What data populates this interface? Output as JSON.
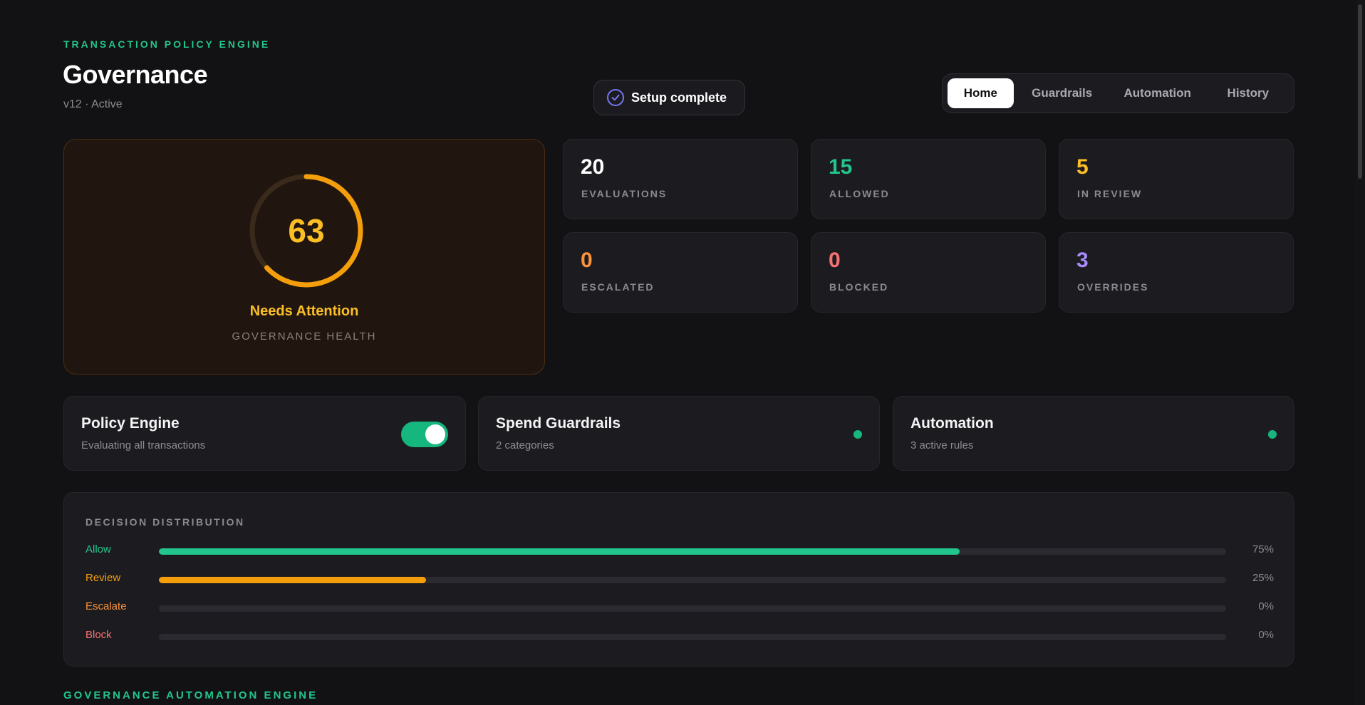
{
  "header": {
    "eyebrow": "TRANSACTION POLICY ENGINE",
    "title": "Governance",
    "subtitle": "v12 · Active",
    "setup_label": "Setup complete",
    "setup_icon": "check-circle-icon"
  },
  "tabs": [
    {
      "label": "Home",
      "active": true
    },
    {
      "label": "Guardrails",
      "active": false
    },
    {
      "label": "Automation",
      "active": false
    },
    {
      "label": "History",
      "active": false
    }
  ],
  "health": {
    "score": "63",
    "score_fraction": 0.63,
    "status": "Needs Attention",
    "caption": "GOVERNANCE HEALTH",
    "color": "#fbbf24"
  },
  "stats": [
    {
      "value": "20",
      "label": "EVALUATIONS",
      "color": "#ffffff"
    },
    {
      "value": "15",
      "label": "ALLOWED",
      "color": "#22c58b"
    },
    {
      "value": "5",
      "label": "IN REVIEW",
      "color": "#fbbf24"
    },
    {
      "value": "0",
      "label": "ESCALATED",
      "color": "#fb923c"
    },
    {
      "value": "0",
      "label": "BLOCKED",
      "color": "#f87171"
    },
    {
      "value": "3",
      "label": "OVERRIDES",
      "color": "#a78bfa"
    }
  ],
  "features": [
    {
      "name": "Policy Engine",
      "desc": "Evaluating all transactions",
      "toggle_on": true
    },
    {
      "name": "Spend Guardrails",
      "desc": "2 categories",
      "status_color": "#16b77f"
    },
    {
      "name": "Automation",
      "desc": "3 active rules",
      "status_color": "#16b77f"
    }
  ],
  "distribution": {
    "title": "DECISION DISTRIBUTION",
    "rows": [
      {
        "label": "Allow",
        "pct_text": "75%",
        "fraction": 0.75,
        "color": "#22c58b"
      },
      {
        "label": "Review",
        "pct_text": "25%",
        "fraction": 0.25,
        "color": "#f59e0b"
      },
      {
        "label": "Escalate",
        "pct_text": "0%",
        "fraction": 0,
        "color": "#fb923c"
      },
      {
        "label": "Block",
        "pct_text": "0%",
        "fraction": 0,
        "color": "#f87171"
      }
    ]
  },
  "section2": {
    "eyebrow": "GOVERNANCE AUTOMATION ENGINE"
  }
}
